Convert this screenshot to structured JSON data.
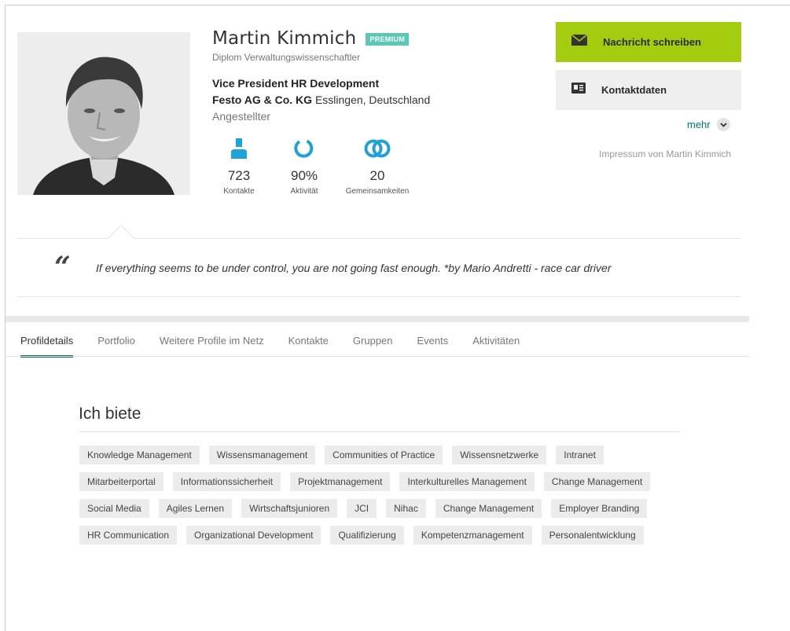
{
  "profile": {
    "name": "Martin Kimmich",
    "badge": "PREMIUM",
    "degree": "Diplom Verwaltungswissenschaftler",
    "job_title": "Vice President HR Development",
    "company": "Festo AG & Co. KG",
    "location": "Esslingen, Deutschland",
    "employment": "Angestellter"
  },
  "stats": [
    {
      "value": "723",
      "label": "Kontakte",
      "icon": "person-icon"
    },
    {
      "value": "90%",
      "label": "Aktivität",
      "icon": "activity-ring-icon"
    },
    {
      "value": "20",
      "label": "Gemeinsamkeiten",
      "icon": "overlap-rings-icon"
    }
  ],
  "actions": {
    "message_label": "Nachricht schreiben",
    "contact_label": "Kontaktdaten",
    "more_label": "mehr",
    "impressum": "Impressum von Martin Kimmich"
  },
  "quote": "If everything seems to be under control, you are not going fast enough. *by Mario Andretti - race car driver",
  "tabs": [
    {
      "label": "Profildetails",
      "active": true
    },
    {
      "label": "Portfolio"
    },
    {
      "label": "Weitere Profile im Netz"
    },
    {
      "label": "Kontakte"
    },
    {
      "label": "Gruppen"
    },
    {
      "label": "Events"
    },
    {
      "label": "Aktivitäten"
    }
  ],
  "offers": {
    "title": "Ich biete",
    "tags": [
      "Knowledge Management",
      "Wissensmanagement",
      "Communities of Practice",
      "Wissensnetzwerke",
      "Intranet",
      "Mitarbeiterportal",
      "Informationssicherheit",
      "Projektmanagement",
      "Interkulturelles Management",
      "Change Management",
      "Social Media",
      "Agiles Lernen",
      "Wirtschaftsjunioren",
      "JCI",
      "Nihac",
      "Change Management",
      "Employer Branding",
      "HR Communication",
      "Organizational Development",
      "Qualifizierung",
      "Kompetenzmanagement",
      "Personalentwicklung"
    ]
  },
  "colors": {
    "accent_green": "#a5cd0f",
    "premium": "#5cc7b5",
    "stat_icon": "#1fa2d8",
    "tab_active": "#0e6e66",
    "link": "#007575"
  }
}
